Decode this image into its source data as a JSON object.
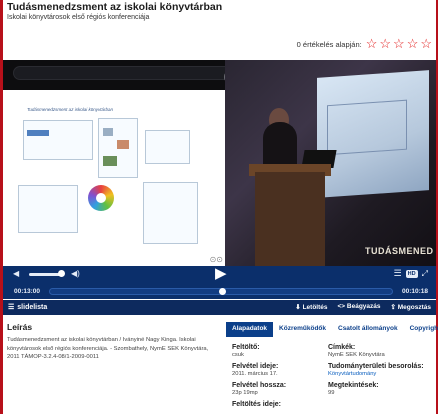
{
  "header": {
    "title": "Tudásmenedzsment az iskolai könyvtárban",
    "subtitle": "Iskolai könyvtárosok első régiós konferenciája"
  },
  "rating": {
    "text": "0 értékelés alapján:",
    "stars": 5,
    "filled": 0
  },
  "player": {
    "slide_title": "Tudásmenedzsment az iskolai könyvtárban",
    "banner_text": "TUDÁSMENED",
    "current_time": "00:13:00",
    "total_time": "00:10:18",
    "progress": 0.505,
    "hd_label": "HD",
    "slides_label": "slidelista",
    "actions": [
      "Letöltés",
      "Beágyazás",
      "Megosztás"
    ]
  },
  "description": {
    "heading": "Leírás",
    "text": "Tudásmenedzsment az iskolai könyvtárban / Iványiné Nagy Kinga. Iskolai könyvtárosok első régiós konferenciája. - Szombathely, NymE SEK Könyvtára, 2011 TÁMOP-3.2.4-08/1-2009-0011"
  },
  "tabs": [
    "Alapadatok",
    "Közreműködők",
    "Csatolt állományok",
    "Copyright"
  ],
  "details": {
    "uploader_label": "Feltöltő:",
    "uploader_value": "csuk",
    "labels_label": "Címkék:",
    "labels_value": "NymE SEK Könyvtára",
    "recorded_label": "Felvétel ideje:",
    "recorded_value": "2011. március 17.",
    "field_label": "Tudományterületi besorolás:",
    "field_value": "Könyvtártudomány",
    "length_label": "Felvétel hossza:",
    "length_value": "23p 19mp",
    "views_label": "Megtekintések:",
    "views_value": "99",
    "upload_time_label": "Feltöltés ideje:"
  },
  "colors": {
    "accent": "#0b3f8a",
    "player_bar": "#0b2f6b",
    "frame": "#b7101a",
    "star": "#e21a1a"
  }
}
